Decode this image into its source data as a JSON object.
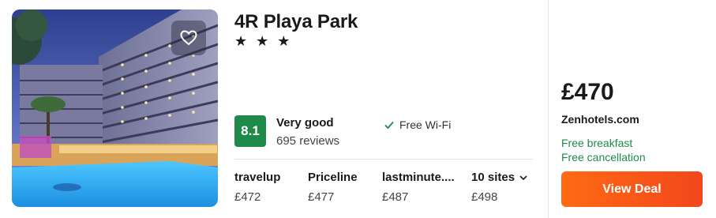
{
  "hotel": {
    "name": "4R Playa Park",
    "stars": "★ ★ ★",
    "star_count": 3
  },
  "rating": {
    "score": "8.1",
    "label": "Very good",
    "reviews": "695 reviews"
  },
  "amenities": [
    "Free Wi-Fi"
  ],
  "sites": [
    {
      "name": "travelup",
      "price": "£472"
    },
    {
      "name": "Priceline",
      "price": "£477"
    },
    {
      "name": "lastminute....",
      "price": "£487"
    },
    {
      "name": "10 sites",
      "price": "£498"
    }
  ],
  "deal": {
    "price": "£470",
    "provider": "Zenhotels.com",
    "perks": [
      "Free breakfast",
      "Free cancellation"
    ],
    "button_label": "View Deal"
  },
  "colors": {
    "rating_green": "#1e8a4a",
    "deal_orange": "#f95a17",
    "perk_green": "#1e8a4a"
  },
  "icons": {
    "favorite": "heart-icon",
    "amenity": "check-icon",
    "more_sites": "chevron-down-icon"
  }
}
